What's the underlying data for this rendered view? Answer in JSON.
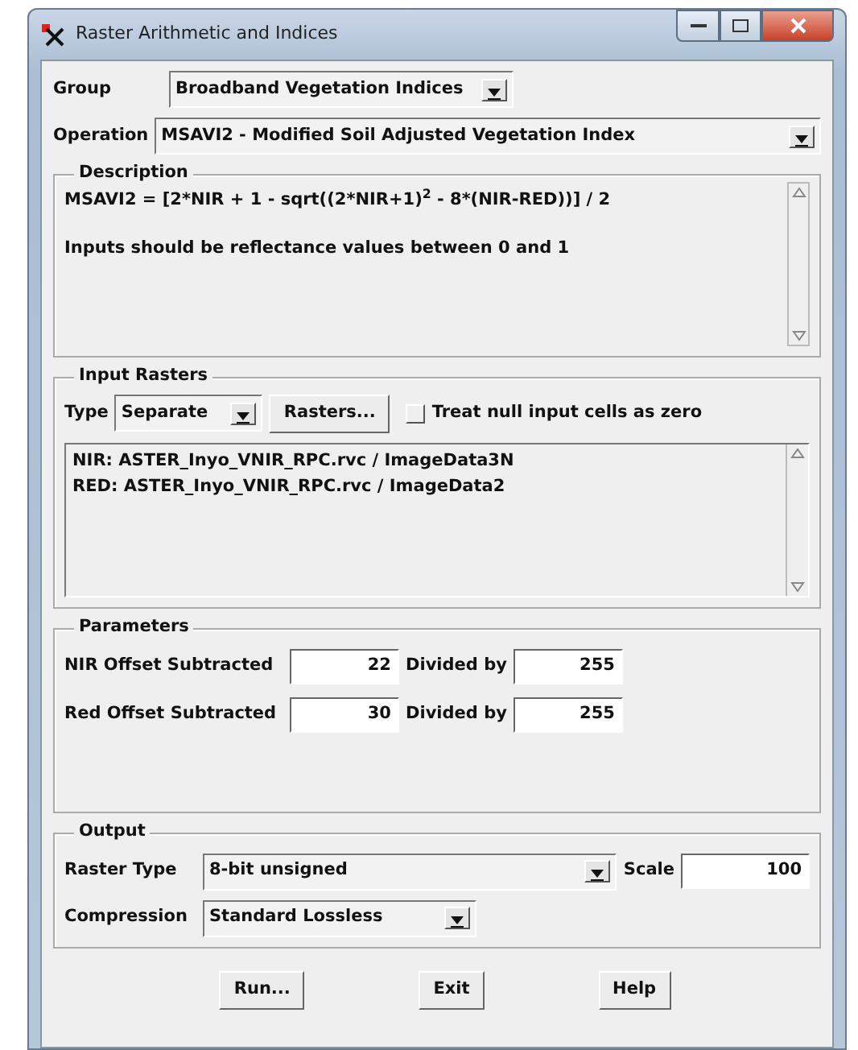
{
  "window": {
    "title": "Raster Arithmetic and Indices"
  },
  "group": {
    "label": "Group",
    "value": "Broadband Vegetation Indices"
  },
  "operation": {
    "label": "Operation",
    "value": "MSAVI2 - Modified Soil Adjusted Vegetation Index"
  },
  "description": {
    "legend": "Description",
    "lines": [
      "MSAVI2 = [2*NIR + 1 - sqrt((2*NIR+1)$^{2}$ - 8*(NIR-RED))] / 2",
      "Inputs should be reflectance values between 0 and 1"
    ]
  },
  "input_rasters": {
    "legend": "Input Rasters",
    "type_label": "Type",
    "type_value": "Separate",
    "rasters_button": "Rasters...",
    "null_checkbox": {
      "label": "Treat null input cells as zero",
      "checked": false
    },
    "items": [
      "NIR: ASTER_Inyo_VNIR_RPC.rvc / ImageData3N",
      "RED: ASTER_Inyo_VNIR_RPC.rvc / ImageData2"
    ]
  },
  "parameters": {
    "legend": "Parameters",
    "rows": [
      {
        "label": "NIR Offset Subtracted",
        "value": "22",
        "divided_label": "Divided by",
        "divided_value": "255"
      },
      {
        "label": "Red Offset Subtracted",
        "value": "30",
        "divided_label": "Divided by",
        "divided_value": "255"
      }
    ]
  },
  "output": {
    "legend": "Output",
    "raster_type": {
      "label": "Raster Type",
      "value": "8-bit unsigned"
    },
    "scale": {
      "label": "Scale",
      "value": "100"
    },
    "compression": {
      "label": "Compression",
      "value": "Standard Lossless"
    }
  },
  "buttons": [
    "Run...",
    "Exit",
    "Help"
  ]
}
